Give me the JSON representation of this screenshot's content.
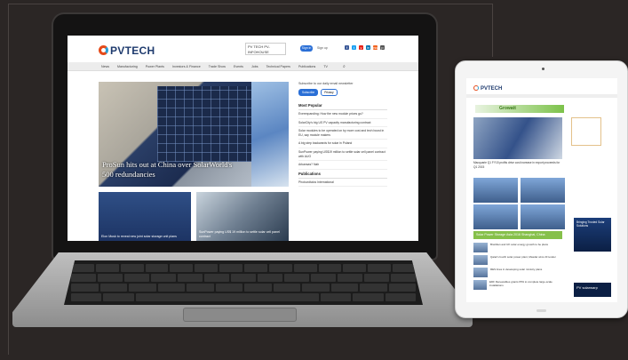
{
  "laptop_site": {
    "logo": "PVTECH",
    "header_ad": "PV TECH PV-INFOHOUSE",
    "sign_in": "Sign in",
    "sign_up": "Sign up",
    "social": [
      "f",
      "t",
      "y",
      "in",
      "rss",
      "p"
    ],
    "nav": [
      "News",
      "Manufacturing",
      "Power Plants",
      "Investors & Finance",
      "Trade Show",
      "Events",
      "Jobs",
      "Technical Papers",
      "Publications",
      "TV"
    ],
    "hero_title": "ProSun hits out at China over SolarWorld's 500 redundancies",
    "card1_caption": "Elon Musk to reveal new joint solar storage unit plans",
    "card2_caption": "SunPower paying US$ 19 million to settle solar cell panel contract",
    "subscribe_text": "Subscribe to our daily email newsletter",
    "subscribe_btn": "Subscribe",
    "privacy_btn": "Privacy",
    "most_popular": "Most Popular",
    "popular_items": [
      "Everexpanding: How the new module prices go?",
      "SolarCity's big US PV capacity manufacturing contract",
      "Solar modules to be operated on by more cost and tech boost in EU, say module makers",
      "A big step backwards for solar in Poland",
      "SunPower paying US$19 million to settle solar cell panel contract with AUO",
      "Arkansas? Nah"
    ],
    "publications": "Publications",
    "publication_item": "Photovoltaics International"
  },
  "tablet_site": {
    "logo": "PVTECH",
    "banner": "Growatt",
    "hero_caption": "Macquarie Q1 FY15 profits drive cost increase in export proceeds for Q1 2015",
    "green_bar": "Solar Power Storage Asia 2016  Shanghai, China",
    "list_items": [
      "Brazilian and UK solar energy growth to be plans",
      "Qatar's fourth solar power plant, Masdar wins 23 tender",
      "RES lines in developing solar ministry plans",
      "EDF Renewables grants PPA to complete large-scale installations"
    ],
    "ad_blue": "Bringing Trusted Solar Solutions",
    "ad_blue2": "PV solarwarp"
  }
}
